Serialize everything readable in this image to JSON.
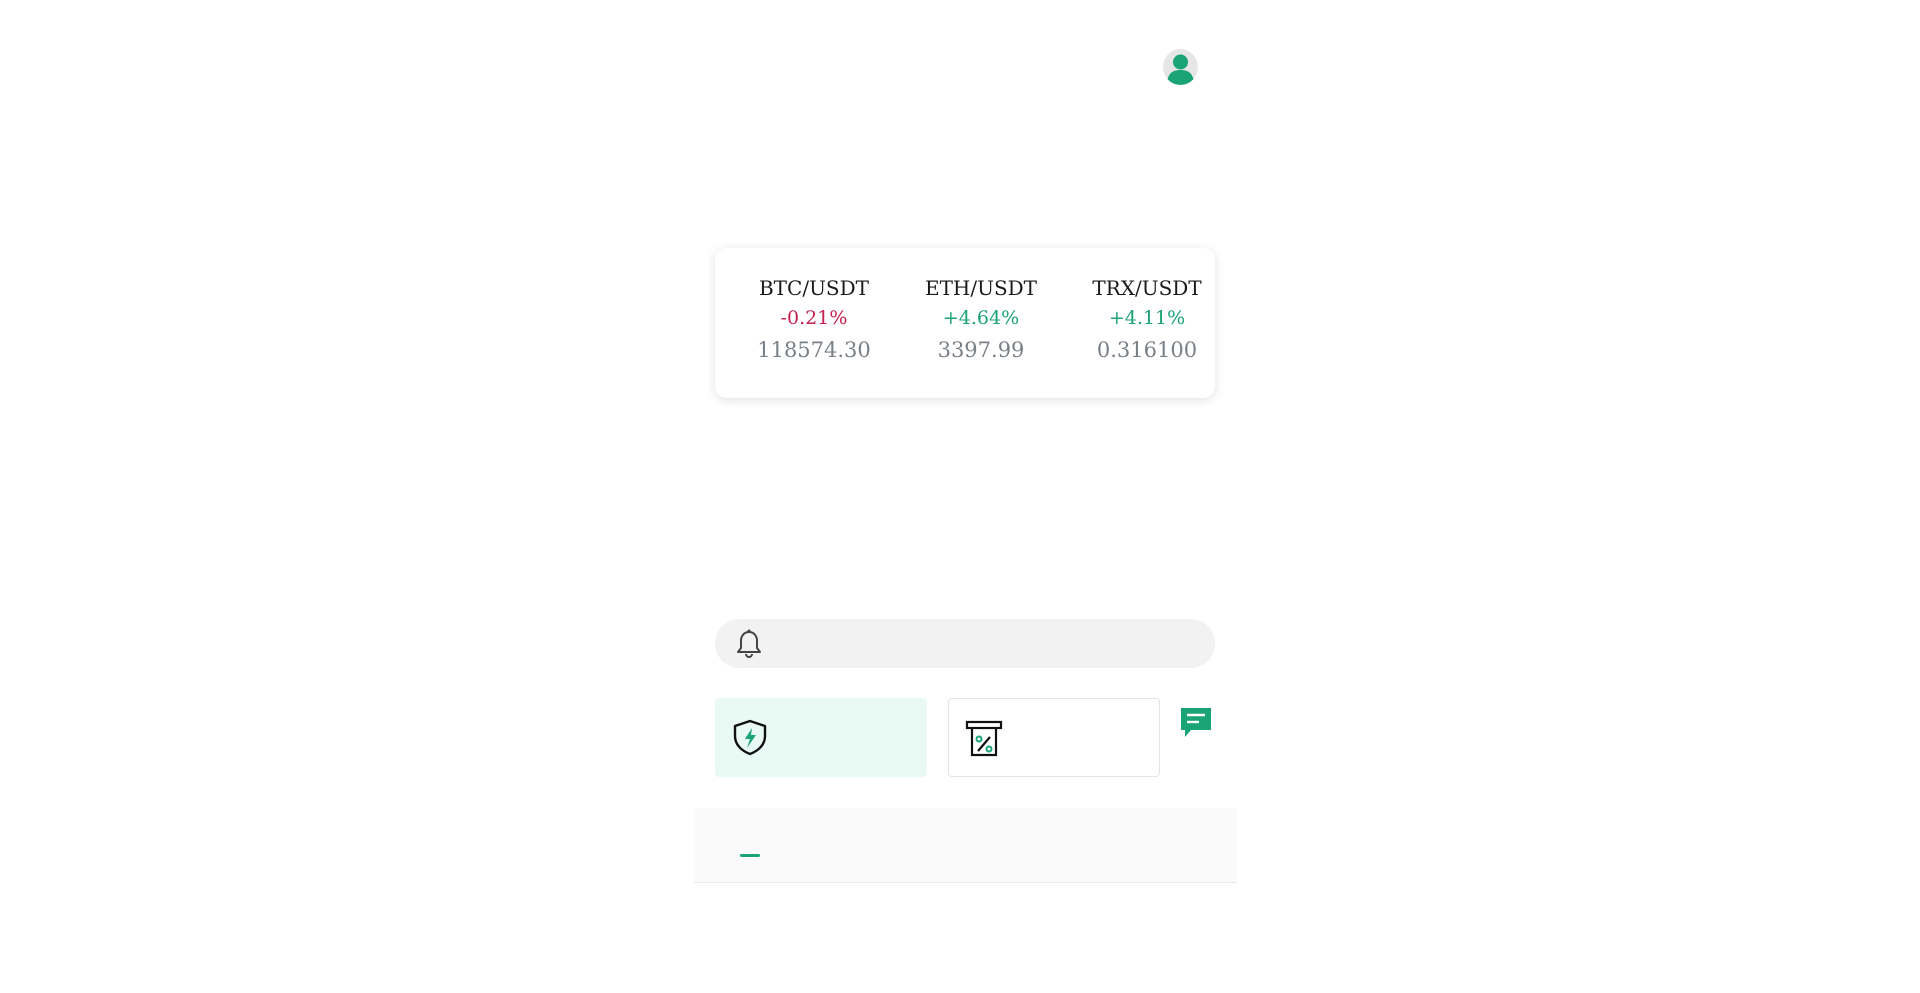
{
  "header": {
    "avatar_icon": "user-avatar-icon"
  },
  "tickers": [
    {
      "pair": "BTC/USDT",
      "change": "-0.21%",
      "price": "118574.30",
      "direction": "down"
    },
    {
      "pair": "ETH/USDT",
      "change": "+4.64%",
      "price": "3397.99",
      "direction": "up"
    },
    {
      "pair": "TRX/USDT",
      "change": "+4.11%",
      "price": "0.316100",
      "direction": "up"
    }
  ],
  "quick_links": [
    {
      "label": ""
    },
    {
      "label": ""
    },
    {
      "label": ""
    },
    {
      "label": ""
    },
    {
      "label": ""
    },
    {
      "label": ""
    }
  ],
  "notice": {
    "icon": "bell-icon",
    "text": ""
  },
  "features": [
    {
      "label": "",
      "icon": "shield-lightning-icon",
      "active": true
    },
    {
      "label": "",
      "icon": "percent-receipt-icon",
      "active": false
    }
  ],
  "chat": {
    "icon": "chat-icon",
    "label": ""
  },
  "tabs": [
    {
      "label": ""
    },
    {
      "label": ""
    },
    {
      "label": ""
    }
  ],
  "subtabs": [
    {
      "label": ""
    },
    {
      "label": ""
    },
    {
      "label": ""
    },
    {
      "label": ""
    }
  ],
  "colors": {
    "accent": "#1aa374",
    "negative": "#c4204f",
    "price": "#7a8088"
  }
}
